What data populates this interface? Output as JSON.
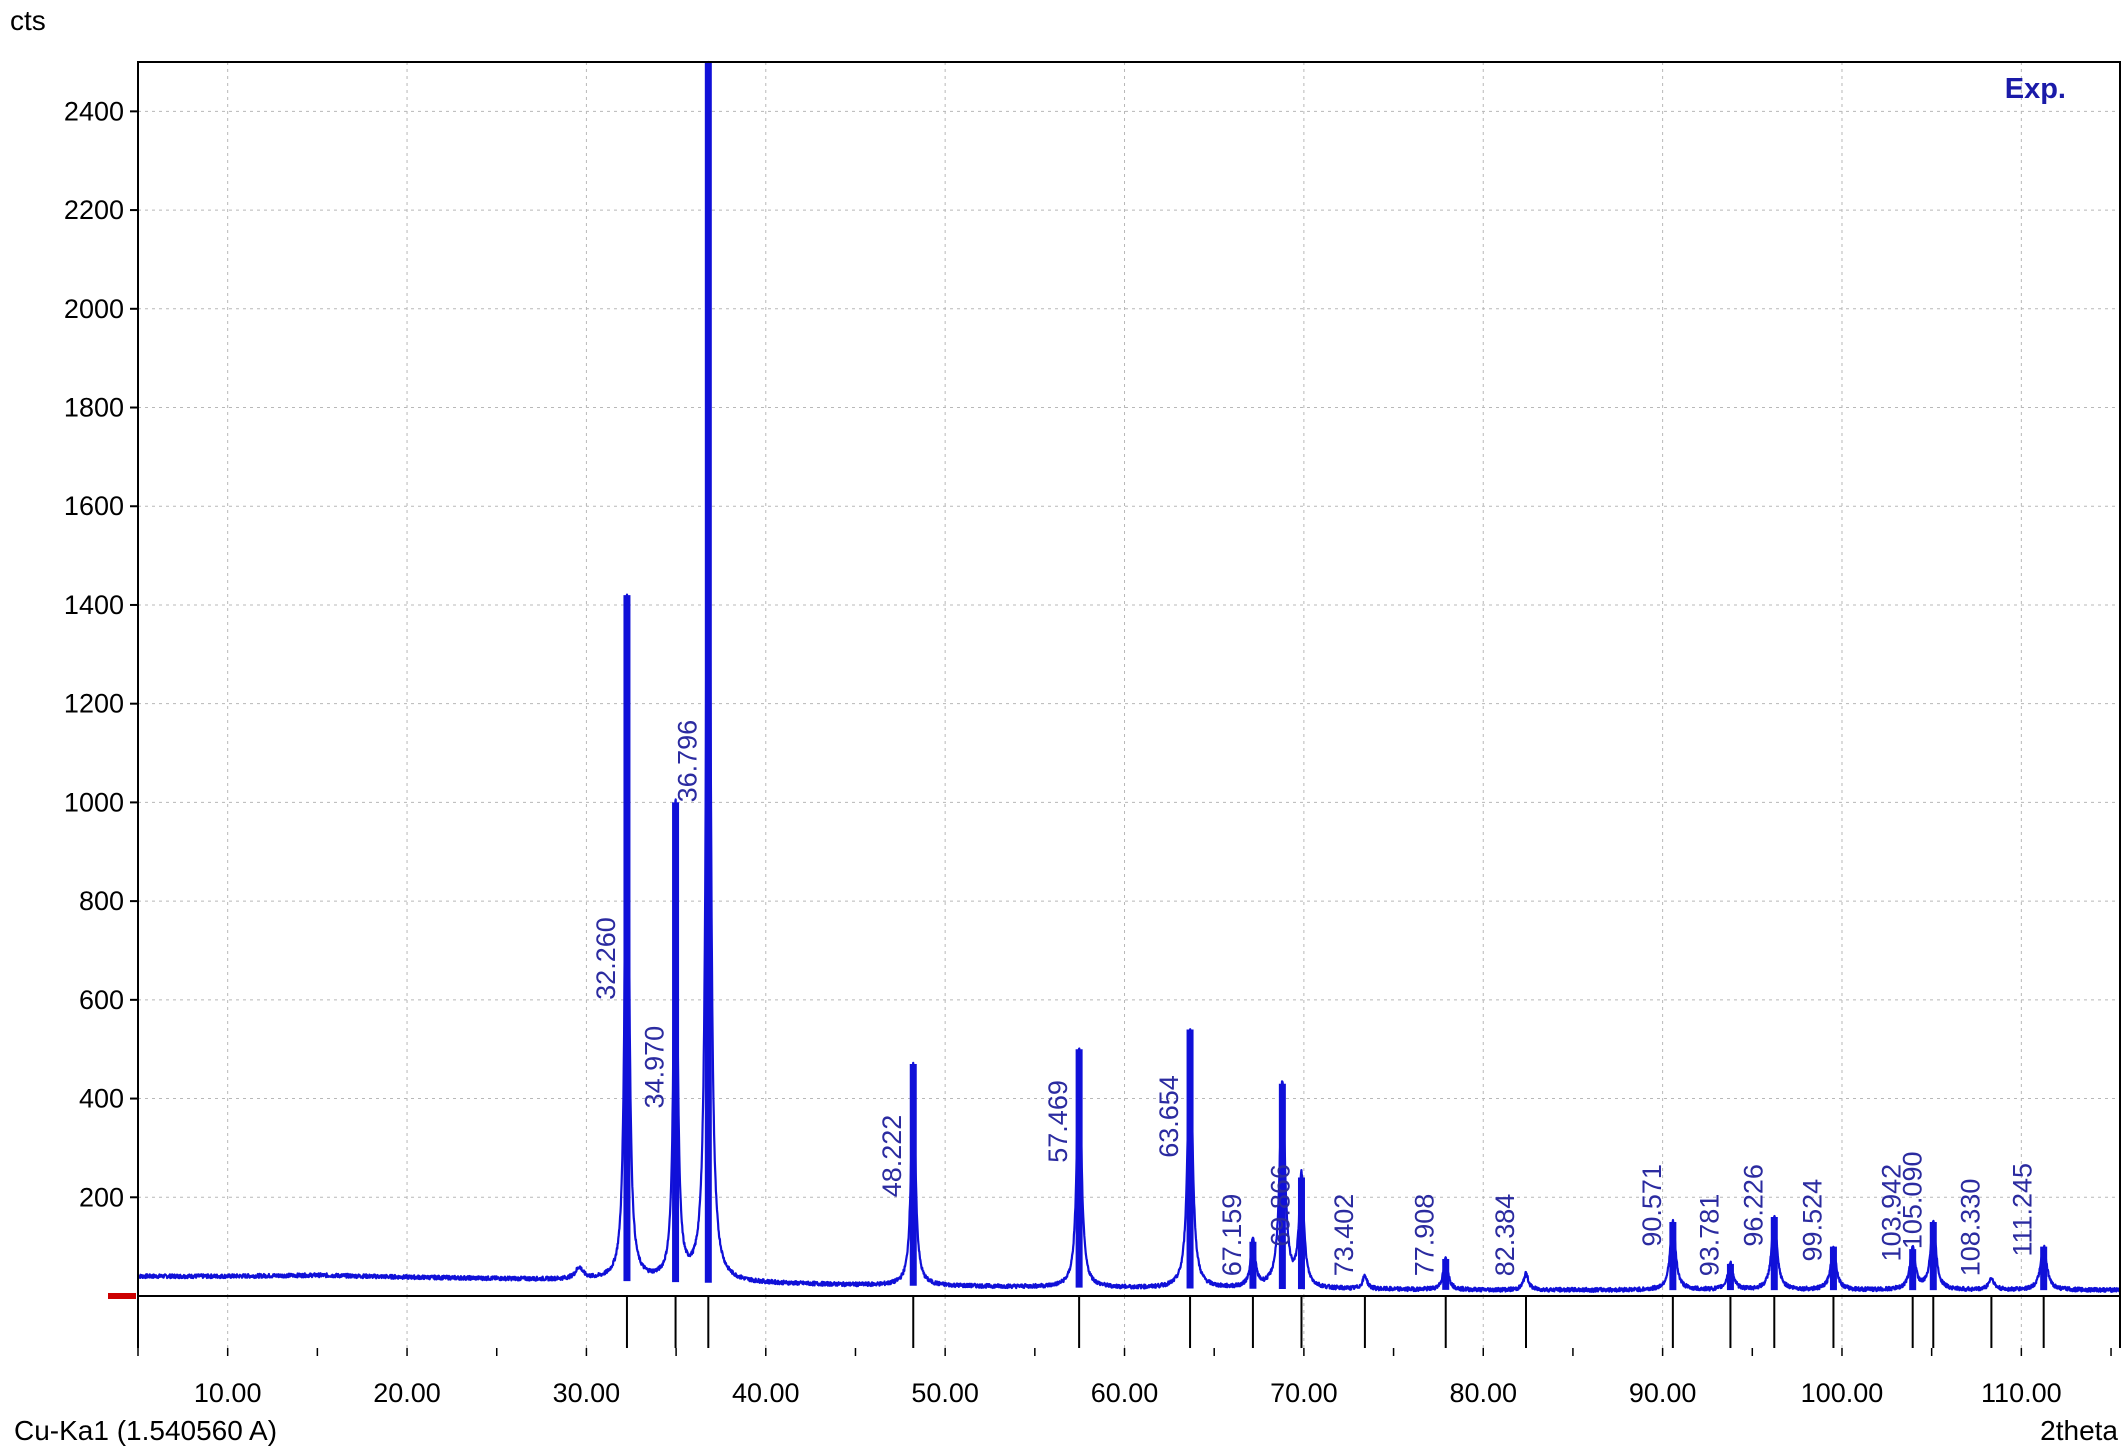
{
  "chart_data": {
    "type": "line",
    "ylabel": "cts",
    "xlabel": "2theta",
    "wavelength_label": "Cu-Ka1 (1.540560 A)",
    "legend": [
      "Exp."
    ],
    "xlim": [
      5,
      115.5
    ],
    "ylim": [
      0,
      2500
    ],
    "y_ticks": [
      200,
      400,
      600,
      800,
      1000,
      1200,
      1400,
      1600,
      1800,
      2000,
      2200,
      2400
    ],
    "y_tick_labels": [
      "200",
      "400",
      "600",
      "800",
      "1000",
      "1200",
      "1400",
      "1600",
      "1800",
      "2000",
      "2200",
      "2400"
    ],
    "x_ticks": [
      10,
      20,
      30,
      40,
      50,
      60,
      70,
      80,
      90,
      100,
      110
    ],
    "x_tick_labels": [
      "10.00",
      "20.00",
      "30.00",
      "40.00",
      "50.00",
      "60.00",
      "70.00",
      "80.00",
      "90.00",
      "100.00",
      "110.00"
    ],
    "grid": true,
    "series": [
      {
        "name": "Exp.",
        "color": "#1010d8",
        "background": [
          [
            5,
            40
          ],
          [
            10,
            40
          ],
          [
            15,
            42
          ],
          [
            20,
            38
          ],
          [
            25,
            35
          ],
          [
            28,
            33
          ],
          [
            30,
            32
          ],
          [
            35,
            28
          ],
          [
            40,
            25
          ],
          [
            45,
            22
          ],
          [
            50,
            20
          ],
          [
            55,
            18
          ],
          [
            60,
            16
          ],
          [
            65,
            15
          ],
          [
            70,
            14
          ],
          [
            80,
            12
          ],
          [
            90,
            12
          ],
          [
            100,
            12
          ],
          [
            110,
            12
          ],
          [
            115.5,
            12
          ]
        ],
        "peaks": [
          {
            "x": 29.6,
            "y": 55,
            "w": 0.25
          },
          {
            "x": 32.26,
            "y": 1420,
            "w": 0.12
          },
          {
            "x": 34.97,
            "y": 1000,
            "w": 0.12
          },
          {
            "x": 36.796,
            "y": 2500,
            "w": 0.12
          },
          {
            "x": 48.222,
            "y": 470,
            "w": 0.14
          },
          {
            "x": 57.469,
            "y": 500,
            "w": 0.15
          },
          {
            "x": 63.654,
            "y": 540,
            "w": 0.16
          },
          {
            "x": 67.159,
            "y": 110,
            "w": 0.15
          },
          {
            "x": 68.8,
            "y": 430,
            "w": 0.18
          },
          {
            "x": 69.866,
            "y": 240,
            "w": 0.16
          },
          {
            "x": 73.402,
            "y": 40,
            "w": 0.15
          },
          {
            "x": 77.908,
            "y": 75,
            "w": 0.16
          },
          {
            "x": 82.384,
            "y": 45,
            "w": 0.16
          },
          {
            "x": 90.571,
            "y": 150,
            "w": 0.18
          },
          {
            "x": 93.781,
            "y": 65,
            "w": 0.18
          },
          {
            "x": 96.226,
            "y": 160,
            "w": 0.18
          },
          {
            "x": 99.524,
            "y": 100,
            "w": 0.18
          },
          {
            "x": 103.942,
            "y": 95,
            "w": 0.18
          },
          {
            "x": 105.09,
            "y": 150,
            "w": 0.18
          },
          {
            "x": 108.33,
            "y": 35,
            "w": 0.18
          },
          {
            "x": 111.245,
            "y": 100,
            "w": 0.2
          }
        ]
      }
    ],
    "peak_markers": [
      {
        "x": 32.26,
        "label": "32.260"
      },
      {
        "x": 34.97,
        "label": "34.970"
      },
      {
        "x": 36.796,
        "label": "36.796"
      },
      {
        "x": 48.222,
        "label": "48.222"
      },
      {
        "x": 57.469,
        "label": "57.469"
      },
      {
        "x": 63.654,
        "label": "63.654"
      },
      {
        "x": 67.159,
        "label": "67.159"
      },
      {
        "x": 69.866,
        "label": "69.866"
      },
      {
        "x": 73.402,
        "label": "73.402"
      },
      {
        "x": 77.908,
        "label": "77.908"
      },
      {
        "x": 82.384,
        "label": "82.384"
      },
      {
        "x": 90.571,
        "label": "90.571"
      },
      {
        "x": 93.781,
        "label": "93.781"
      },
      {
        "x": 96.226,
        "label": "96.226"
      },
      {
        "x": 99.524,
        "label": "99.524"
      },
      {
        "x": 103.942,
        "label": "103.942"
      },
      {
        "x": 105.09,
        "label": "105.090"
      },
      {
        "x": 108.33,
        "label": "108.330"
      },
      {
        "x": 111.245,
        "label": "111.245"
      }
    ],
    "peak_label_y": [
      600,
      380,
      1000,
      200,
      270,
      280,
      40,
      100,
      40,
      40,
      40,
      100,
      40,
      100,
      70,
      70,
      95,
      40,
      80
    ]
  }
}
